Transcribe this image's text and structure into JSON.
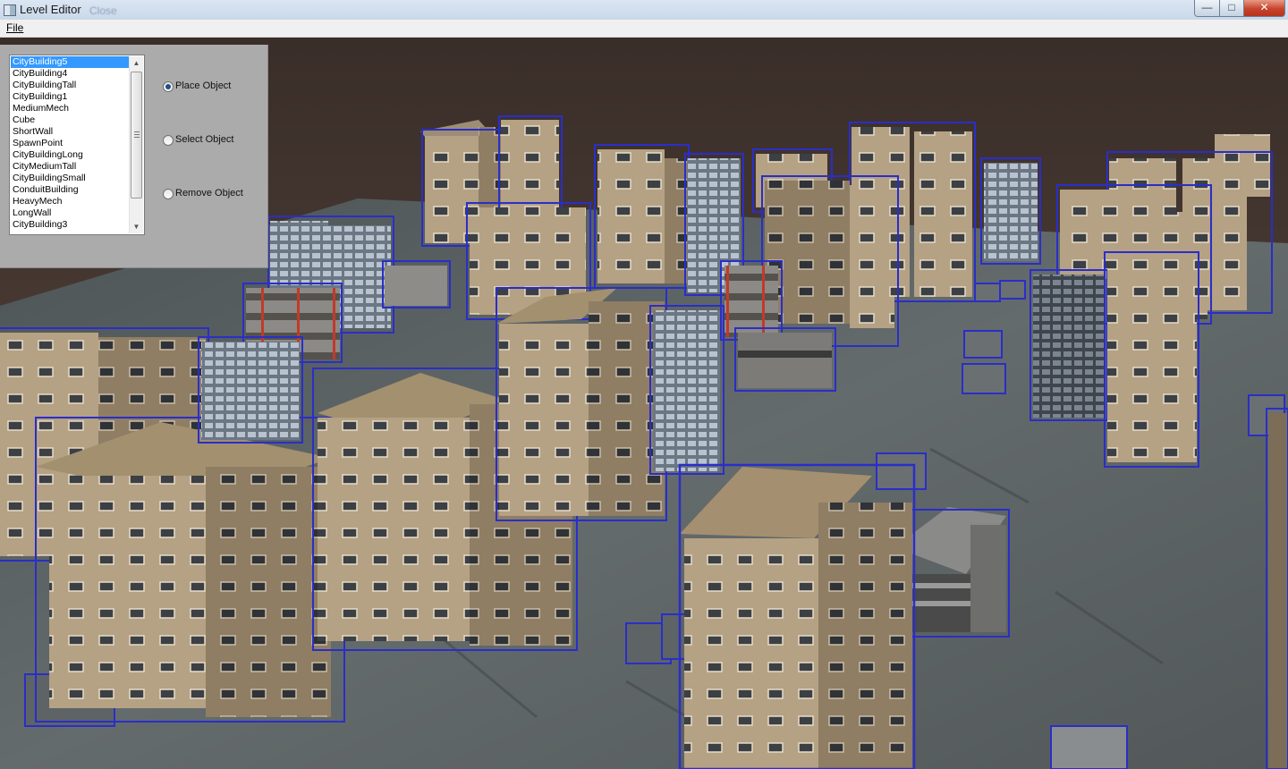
{
  "window": {
    "title": "Level Editor",
    "title_ghost": "Close",
    "controls": {
      "minimize": "—",
      "maximize": "□",
      "close": "✕"
    }
  },
  "menu": {
    "file": "File"
  },
  "panel": {
    "objects": [
      "CityBuilding5",
      "CityBuilding4",
      "CityBuildingTall",
      "CityBuilding1",
      "MediumMech",
      "Cube",
      "ShortWall",
      "SpawnPoint",
      "CityBuildingLong",
      "CityMediumTall",
      "CityBuildingSmall",
      "ConduitBuilding",
      "HeavyMech",
      "LongWall",
      "CityBuilding3"
    ],
    "selected_object": "CityBuilding5",
    "modes": [
      "Place Object",
      "Select Object",
      "Remove Object"
    ],
    "selected_mode": "Place Object"
  },
  "colors": {
    "selection_box": "#2a2ec8",
    "sky": "#4a3a32",
    "ground": "#5f6668",
    "building_tan": "#b8a588",
    "building_glass": "#8a96a4",
    "list_highlight": "#3399ff"
  }
}
